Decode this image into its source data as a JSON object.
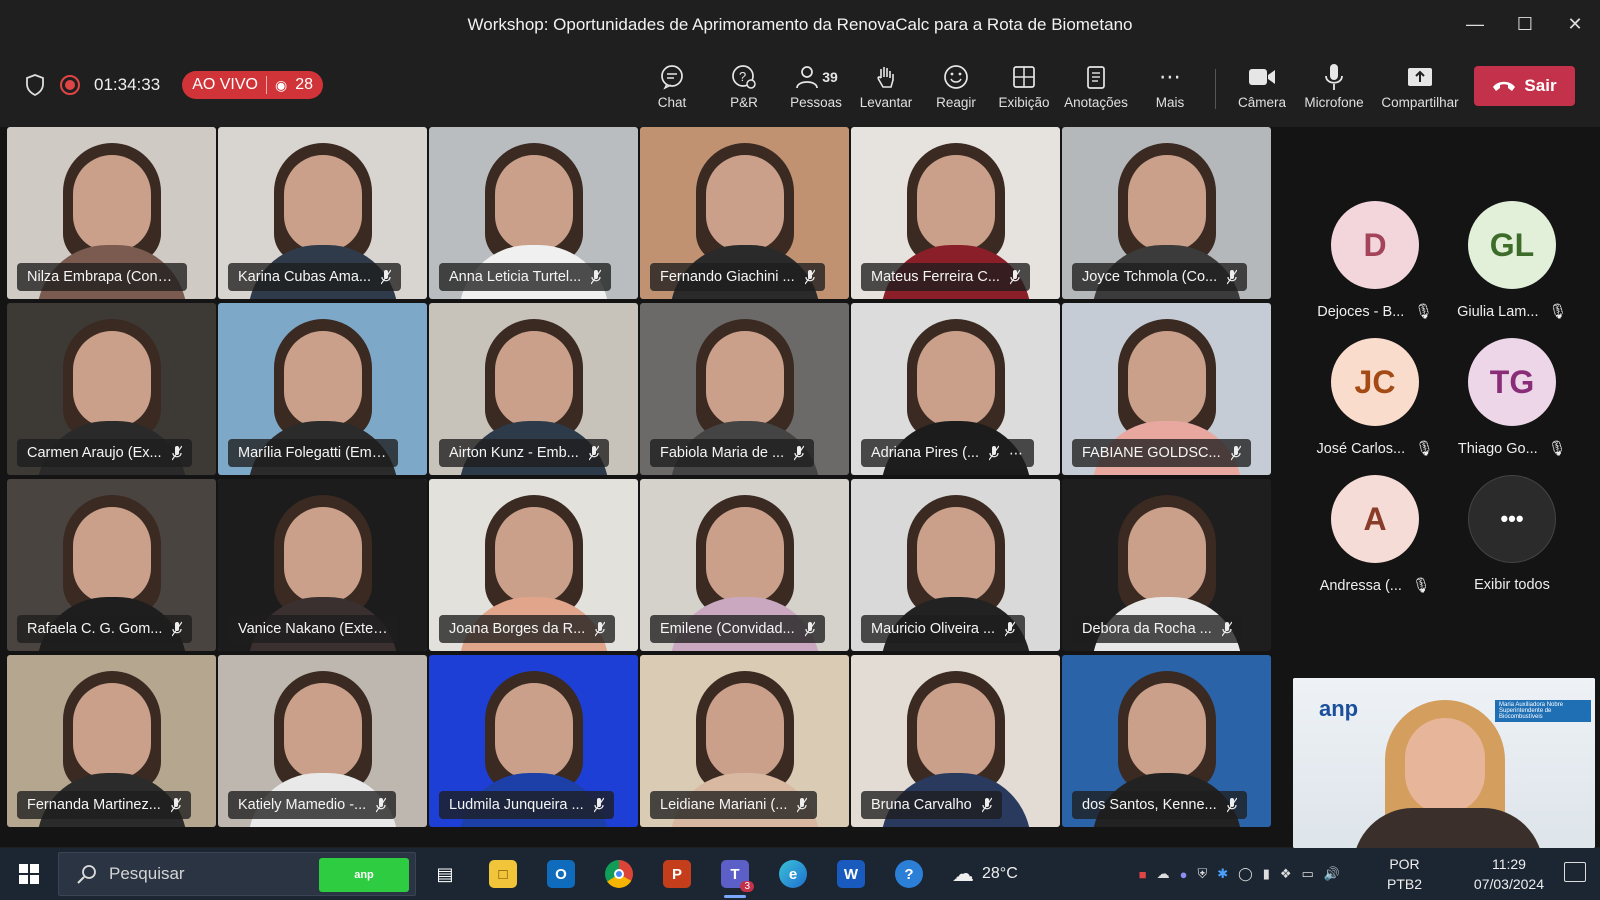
{
  "window": {
    "title": "Workshop: Oportunidades de Aprimoramento da RenovaCalc para a Rota de Biometano"
  },
  "toolbar": {
    "timer": "01:34:33",
    "live_label": "AO VIVO",
    "viewers": "28",
    "people_count": "39",
    "items": [
      {
        "label": "Chat",
        "icon": "chat-icon"
      },
      {
        "label": "P&R",
        "icon": "qa-icon"
      },
      {
        "label": "Pessoas",
        "icon": "people-icon"
      },
      {
        "label": "Levantar",
        "icon": "raise-hand-icon"
      },
      {
        "label": "Reagir",
        "icon": "react-icon"
      },
      {
        "label": "Exibição",
        "icon": "view-icon"
      },
      {
        "label": "Anotações",
        "icon": "notes-icon"
      },
      {
        "label": "Mais",
        "icon": "more-icon"
      },
      {
        "label": "Câmera",
        "icon": "camera-icon"
      },
      {
        "label": "Microfone",
        "icon": "microphone-icon"
      },
      {
        "label": "Compartilhar",
        "icon": "share-icon"
      }
    ],
    "leave_label": "Sair"
  },
  "participants": [
    {
      "name": "Nilza Embrapa (Convid...",
      "muted": false
    },
    {
      "name": "Karina Cubas Ama...",
      "muted": true
    },
    {
      "name": "Anna Leticia Turtel...",
      "muted": true
    },
    {
      "name": "Fernando Giachini ...",
      "muted": true
    },
    {
      "name": "Mateus Ferreira C...",
      "muted": true
    },
    {
      "name": "Joyce Tchmola (Co...",
      "muted": true
    },
    {
      "name": "Carmen Araujo (Ex...",
      "muted": true
    },
    {
      "name": "Marília Folegatti (Embr...",
      "muted": false
    },
    {
      "name": "Airton Kunz - Emb...",
      "muted": true
    },
    {
      "name": "Fabiola Maria de ...",
      "muted": true
    },
    {
      "name": "Adriana Pires (...",
      "muted": true
    },
    {
      "name": "FABIANE GOLDSC...",
      "muted": true
    },
    {
      "name": "Rafaela C. G. Gom...",
      "muted": true
    },
    {
      "name": "Vanice Nakano (Externo)",
      "muted": false
    },
    {
      "name": "Joana Borges da R...",
      "muted": true
    },
    {
      "name": "Emilene (Convidad...",
      "muted": true
    },
    {
      "name": "Mauricio Oliveira ...",
      "muted": true
    },
    {
      "name": "Debora da Rocha ...",
      "muted": true
    },
    {
      "name": "Fernanda Martinez...",
      "muted": true
    },
    {
      "name": "Katiely Mamedio -...",
      "muted": true
    },
    {
      "name": "Ludmila Junqueira ...",
      "muted": true
    },
    {
      "name": "Leidiane Mariani (...",
      "muted": true
    },
    {
      "name": "Bruna Carvalho",
      "muted": true
    },
    {
      "name": "dos Santos, Kenne...",
      "muted": true
    }
  ],
  "avatars": [
    {
      "initials": "D",
      "name": "Dejoces - B...",
      "color": "#f3d6dc",
      "text": "#a3445a"
    },
    {
      "initials": "GL",
      "name": "Giulia Lam...",
      "color": "#e2efd9",
      "text": "#3d6b2a"
    },
    {
      "initials": "JC",
      "name": "José Carlos...",
      "color": "#f9dccc",
      "text": "#a44a14"
    },
    {
      "initials": "TG",
      "name": "Thiago Go...",
      "color": "#ecd6e8",
      "text": "#8a2d78"
    },
    {
      "initials": "A",
      "name": "Andressa (...",
      "color": "#f6dcd6",
      "text": "#8a3c2a"
    },
    {
      "initials": "•••",
      "name": "Exibir todos",
      "color": "#2b2b2b",
      "text": "#ffffff"
    }
  ],
  "speaker": {
    "logo_text": "anp",
    "banner_text": "Maria Auxiliadora Nobre\nSuperintendente de Biocombustíveis"
  },
  "taskbar": {
    "search_placeholder": "Pesquisar",
    "search_badge": "anp",
    "temperature": "28°C",
    "lang_top": "POR",
    "lang_bottom": "PTB2",
    "time": "11:29",
    "date": "07/03/2024",
    "teams_badge": "3"
  }
}
